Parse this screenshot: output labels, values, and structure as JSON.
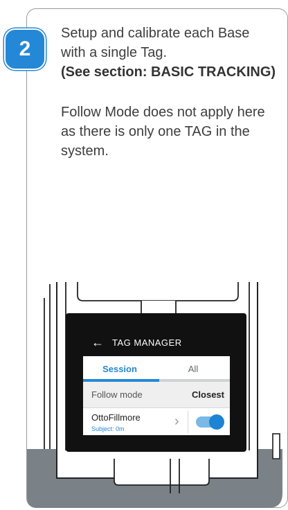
{
  "step": {
    "number": "2"
  },
  "instructions": {
    "line1": "Setup and calibrate each Base",
    "line2": "with a single Tag.",
    "reference": "(See section: BASIC TRACKING)",
    "note1": "Follow Mode does not apply here",
    "note2": "as there is only one TAG in the",
    "note3": "system."
  },
  "device_screen": {
    "back_icon": "arrow-left-icon",
    "title": "TAG MANAGER",
    "tabs": [
      {
        "label": "Session",
        "active": true
      },
      {
        "label": "All",
        "active": false
      }
    ],
    "follow_mode": {
      "label": "Follow mode",
      "value": "Closest"
    },
    "tag": {
      "name": "OttoFillmore",
      "subtitle": "Subject: 0m",
      "toggle_on": true
    }
  },
  "colors": {
    "accent": "#2488d6",
    "screen_bg": "#111111",
    "base_tray": "#7a8288"
  }
}
